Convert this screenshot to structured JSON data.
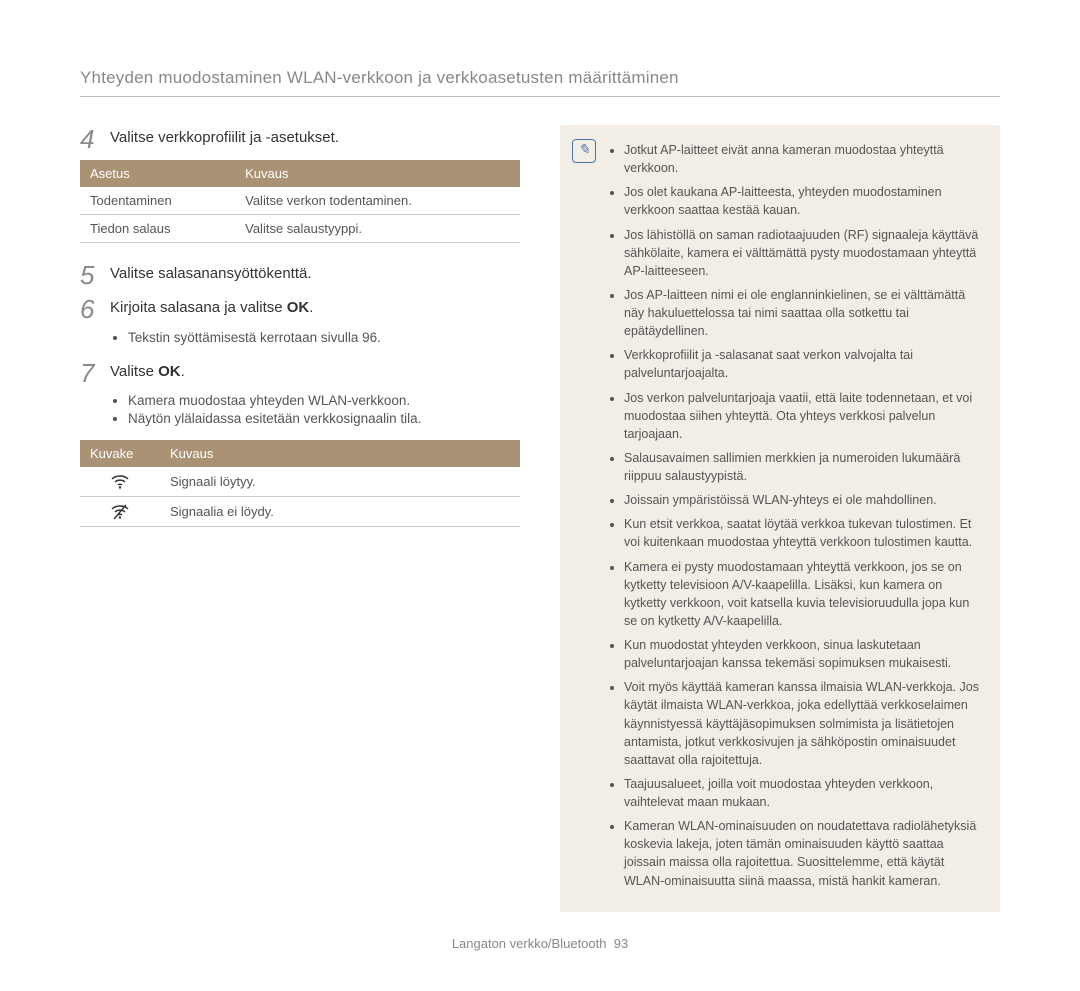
{
  "header": {
    "title": "Yhteyden muodostaminen WLAN-verkkoon ja verkkoasetusten määrittäminen"
  },
  "steps": {
    "s4": {
      "num": "4",
      "text": "Valitse verkkoprofiilit ja -asetukset."
    },
    "s5": {
      "num": "5",
      "text": "Valitse salasanansyöttökenttä."
    },
    "s6": {
      "num": "6",
      "text_prefix": "Kirjoita salasana ja valitse ",
      "ok": "OK",
      "text_suffix": "."
    },
    "s7": {
      "num": "7",
      "text_prefix": "Valitse ",
      "ok": "OK",
      "text_suffix": "."
    }
  },
  "settings_table": {
    "headers": {
      "col1": "Asetus",
      "col2": "Kuvaus"
    },
    "rows": [
      {
        "c1": "Todentaminen",
        "c2": "Valitse verkon todentaminen."
      },
      {
        "c1": "Tiedon salaus",
        "c2": "Valitse salaustyyppi."
      }
    ]
  },
  "sub_bullets_6": [
    "Tekstin syöttämisestä kerrotaan sivulla 96."
  ],
  "sub_bullets_7": [
    "Kamera muodostaa yhteyden WLAN-verkkoon.",
    "Näytön ylälaidassa esitetään verkkosignaalin tila."
  ],
  "icons_table": {
    "headers": {
      "col1": "Kuvake",
      "col2": "Kuvaus"
    },
    "rows": [
      {
        "icon": "wifi-found-icon",
        "desc": "Signaali löytyy."
      },
      {
        "icon": "wifi-not-found-icon",
        "desc": "Signaalia ei löydy."
      }
    ]
  },
  "notes": [
    "Jotkut AP-laitteet eivät anna kameran muodostaa yhteyttä verkkoon.",
    "Jos olet kaukana AP-laitteesta, yhteyden muodostaminen verkkoon saattaa kestää kauan.",
    "Jos lähistöllä on saman radiotaajuuden (RF) signaaleja käyttävä sähkölaite, kamera ei välttämättä pysty muodostamaan yhteyttä AP-laitteeseen.",
    "Jos AP-laitteen nimi ei ole englanninkielinen, se ei välttämättä näy hakuluettelossa tai nimi saattaa olla sotkettu tai epätäydellinen.",
    "Verkkoprofiilit ja -salasanat saat verkon valvojalta tai palveluntarjoajalta.",
    "Jos verkon palveluntarjoaja vaatii, että laite todennetaan, et voi muodostaa siihen yhteyttä. Ota yhteys verkkosi palvelun tarjoajaan.",
    "Salausavaimen sallimien merkkien ja numeroiden lukumäärä riippuu salaustyypistä.",
    "Joissain ympäristöissä WLAN-yhteys ei ole mahdollinen.",
    "Kun etsit verkkoa, saatat löytää verkkoa tukevan tulostimen. Et voi kuitenkaan muodostaa yhteyttä verkkoon tulostimen kautta.",
    "Kamera ei pysty muodostamaan yhteyttä verkkoon, jos se on kytketty televisioon A/V-kaapelilla. Lisäksi, kun kamera on kytketty verkkoon, voit katsella kuvia televisioruudulla jopa kun se on kytketty A/V-kaapelilla.",
    "Kun muodostat yhteyden verkkoon, sinua laskutetaan palveluntarjoajan kanssa tekemäsi sopimuksen mukaisesti.",
    "Voit myös käyttää kameran kanssa ilmaisia WLAN-verkkoja. Jos käytät ilmaista WLAN-verkkoa, joka edellyttää verkkoselaimen käynnistyessä käyttäjäsopimuksen solmimista ja lisätietojen antamista, jotkut verkkosivujen ja sähköpostin ominaisuudet saattavat olla rajoitettuja.",
    "Taajuusalueet, joilla voit muodostaa yhteyden verkkoon, vaihtelevat maan mukaan.",
    "Kameran WLAN-ominaisuuden on noudatettava radiolähetyksiä koskevia lakeja, joten tämän ominaisuuden käyttö saattaa joissain maissa olla rajoitettua. Suosittelemme, että käytät WLAN-ominaisuutta siinä maassa, mistä hankit kameran."
  ],
  "footer": {
    "section": "Langaton verkko/Bluetooth",
    "page": "93"
  }
}
